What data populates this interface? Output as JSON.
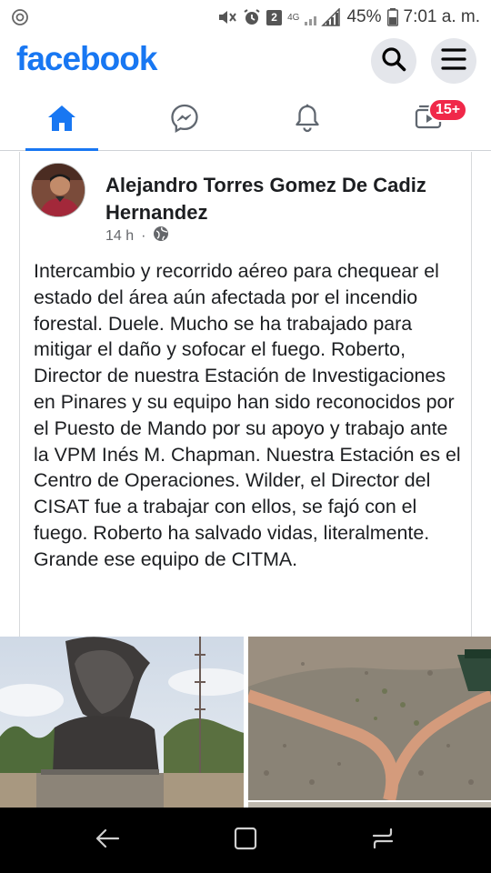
{
  "status_bar": {
    "battery_percent": "45%",
    "time": "7:01 a. m.",
    "notification_count": "2",
    "network": "4G",
    "icons": [
      "ring-icon",
      "mute-icon",
      "alarm-icon",
      "signal-icon",
      "battery-icon"
    ]
  },
  "header": {
    "logo": "facebook",
    "brand_color": "#1877f2",
    "icons": [
      "search-icon",
      "menu-icon"
    ]
  },
  "nav": {
    "tabs": [
      {
        "name": "home",
        "icon": "home-icon",
        "active": true
      },
      {
        "name": "messenger",
        "icon": "messenger-icon",
        "active": false
      },
      {
        "name": "notifications",
        "icon": "bell-icon",
        "active": false
      },
      {
        "name": "watch",
        "icon": "watch-icon",
        "active": false,
        "badge": "15+"
      }
    ]
  },
  "post": {
    "author": "Alejandro Torres Gomez De Cadiz Hernandez",
    "time": "14 h",
    "separator": "·",
    "privacy_icon": "globe-icon",
    "text": "Intercambio y recorrido aéreo para chequear el estado del área aún afectada por el incendio forestal. Duele. Mucho se ha trabajado para mitigar el daño y sofocar el fuego. Roberto, Director de nuestra Estación de Investigaciones en Pinares y su equipo han sido reconocidos por el Puesto de Mando por su apoyo y trabajo ante la VPM Inés M. Chapman. Nuestra Estación es el Centro de Operaciones. Wilder, el Director del CISAT fue a trabajar con ellos, se fajó con el fuego. Roberto ha salvado vidas, literalmente. Grande ese equipo de CITMA.",
    "photos": [
      "bust-monument-photo",
      "aerial-burned-area-photo",
      "partial-photo"
    ]
  },
  "android_nav": {
    "icons": [
      "back-icon",
      "home-square-icon",
      "recents-icon"
    ]
  }
}
